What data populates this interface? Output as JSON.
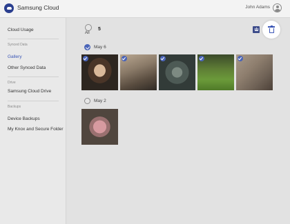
{
  "header": {
    "app_title": "Samsung Cloud",
    "user_name": "John Adams"
  },
  "sidebar": {
    "cloud_usage": "Cloud Usage",
    "synced_data_heading": "Synced Data",
    "gallery": "Gallery",
    "other_synced_data": "Other Synced Data",
    "drive_heading": "Drive",
    "samsung_cloud_drive": "Samsung Cloud Drive",
    "backups_heading": "Backups",
    "device_backups": "Device Backups",
    "knox_folder": "My Knox and Secure Folder",
    "active_color": "#3b56b6"
  },
  "toolbar": {
    "select_all_label": "All",
    "selected_count": "5",
    "download_icon": "download-icon",
    "delete_icon": "trash-icon"
  },
  "groups": [
    {
      "date": "May 6",
      "checked": true,
      "photo_count": 5
    },
    {
      "date": "May 2",
      "checked": false,
      "photo_count": 1
    }
  ]
}
